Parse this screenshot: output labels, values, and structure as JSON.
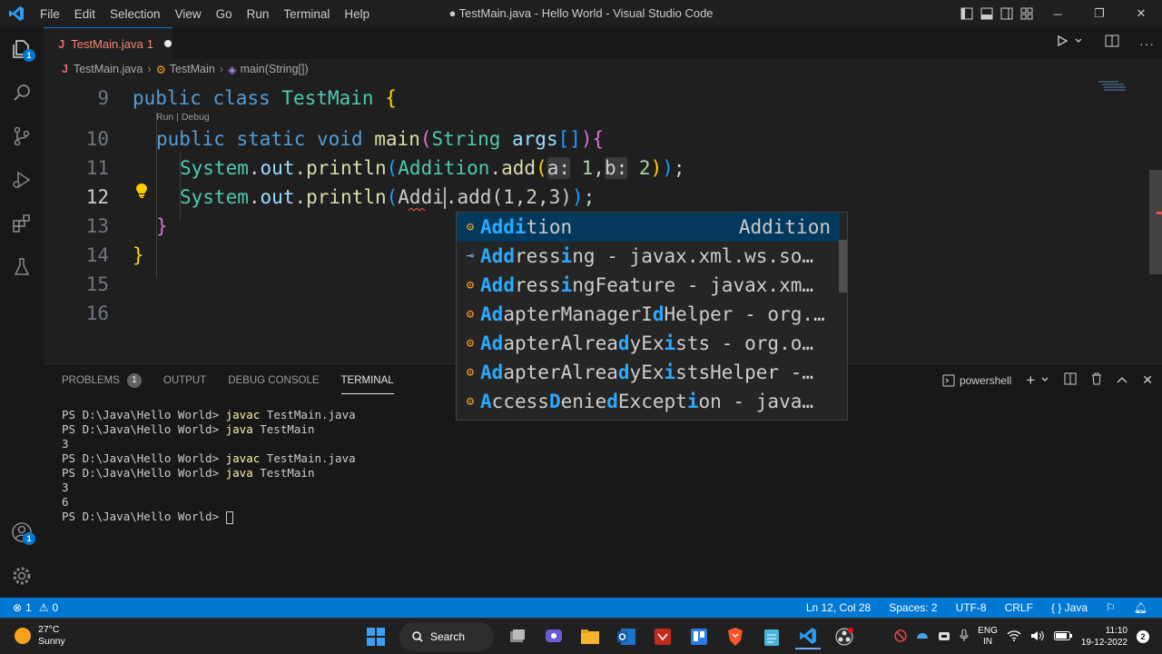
{
  "window": {
    "title": "● TestMain.java - Hello World - Visual Studio Code",
    "menu": [
      "File",
      "Edit",
      "Selection",
      "View",
      "Go",
      "Run",
      "Terminal",
      "Help"
    ]
  },
  "activity": {
    "explorer_badge": "1",
    "accounts_badge": "1"
  },
  "tab": {
    "file_icon": "J",
    "name": "TestMain.java",
    "problem_count": "1"
  },
  "breadcrumb": {
    "file_icon": "J",
    "file": "TestMain.java",
    "class": "TestMain",
    "method": "main(String[])"
  },
  "editor": {
    "line_numbers": [
      "9",
      "10",
      "11",
      "12",
      "13",
      "14",
      "15",
      "16"
    ],
    "codelens": "Run | Debug",
    "line9": {
      "kw1": "public",
      "kw2": "class",
      "name": "TestMain",
      "brace": "{"
    },
    "line10": {
      "kw1": "public",
      "kw2": "static",
      "kw3": "void",
      "fn": "main",
      "open": "(",
      "type": "String",
      "param": "args",
      "brackets": "[]",
      "close": ")",
      "brace": "{"
    },
    "line11": {
      "sys": "System",
      "out": "out",
      "fn": "println",
      "open": "(",
      "cls": "Addition",
      "add": "add",
      "open2": "(",
      "hint_a": "a:",
      "val1": "1",
      "hint_b": "b:",
      "val2": "2",
      "close2": ")",
      "close": ")",
      "semi": ";"
    },
    "line12": {
      "sys": "System",
      "out": "out",
      "fn": "println",
      "open": "(",
      "typed": "Addi",
      "add": ".add",
      "args": "(1,2,3)",
      "close": ")",
      "semi": ";"
    },
    "line13": {
      "brace": "}"
    },
    "line14": {
      "brace": "}"
    }
  },
  "suggestions": [
    {
      "icon": "class-icon",
      "match": "Addi",
      "rest": "tion",
      "detail": "Addition",
      "selected": true
    },
    {
      "icon": "interface-icon",
      "label": "Addressing - javax.xml.ws.so…"
    },
    {
      "icon": "class-icon",
      "label": "AddressingFeature - javax.xm…"
    },
    {
      "icon": "class-icon",
      "label": "AdapterManagerIdHelper - org.…"
    },
    {
      "icon": "class-icon",
      "label": "AdapterAlreadyExists - org.o…"
    },
    {
      "icon": "class-icon",
      "label": "AdapterAlreadyExistsHelper -…"
    },
    {
      "icon": "class-icon",
      "label": "AccessDeniedException - java…"
    }
  ],
  "panel": {
    "tabs": [
      "PROBLEMS",
      "OUTPUT",
      "DEBUG CONSOLE",
      "TERMINAL"
    ],
    "problems_badge": "1",
    "shell": "powershell",
    "terminal": {
      "prompt": "PS D:\\Java\\Hello World> ",
      "cmd_javac": "javac",
      "arg_javac": " TestMain.java",
      "cmd_java": "java",
      "arg_java": " TestMain",
      "out1": "3",
      "out2": "3",
      "out3": "6"
    }
  },
  "status": {
    "errors": "1",
    "warnings": "0",
    "position": "Ln 12, Col 28",
    "spaces": "Spaces: 2",
    "encoding": "UTF-8",
    "eol": "CRLF",
    "language_braces": "{ }",
    "language": "Java"
  },
  "taskbar": {
    "temperature": "27°C",
    "condition": "Sunny",
    "search": "Search",
    "lang1": "ENG",
    "lang2": "IN",
    "time": "11:10",
    "date": "19-12-2022",
    "notifications": "2"
  },
  "colors": {
    "accent": "#0078d4",
    "keyword": "#569cd6",
    "class": "#4ec9b0",
    "function": "#dcdcaa",
    "match_highlight": "#2aaaff"
  }
}
